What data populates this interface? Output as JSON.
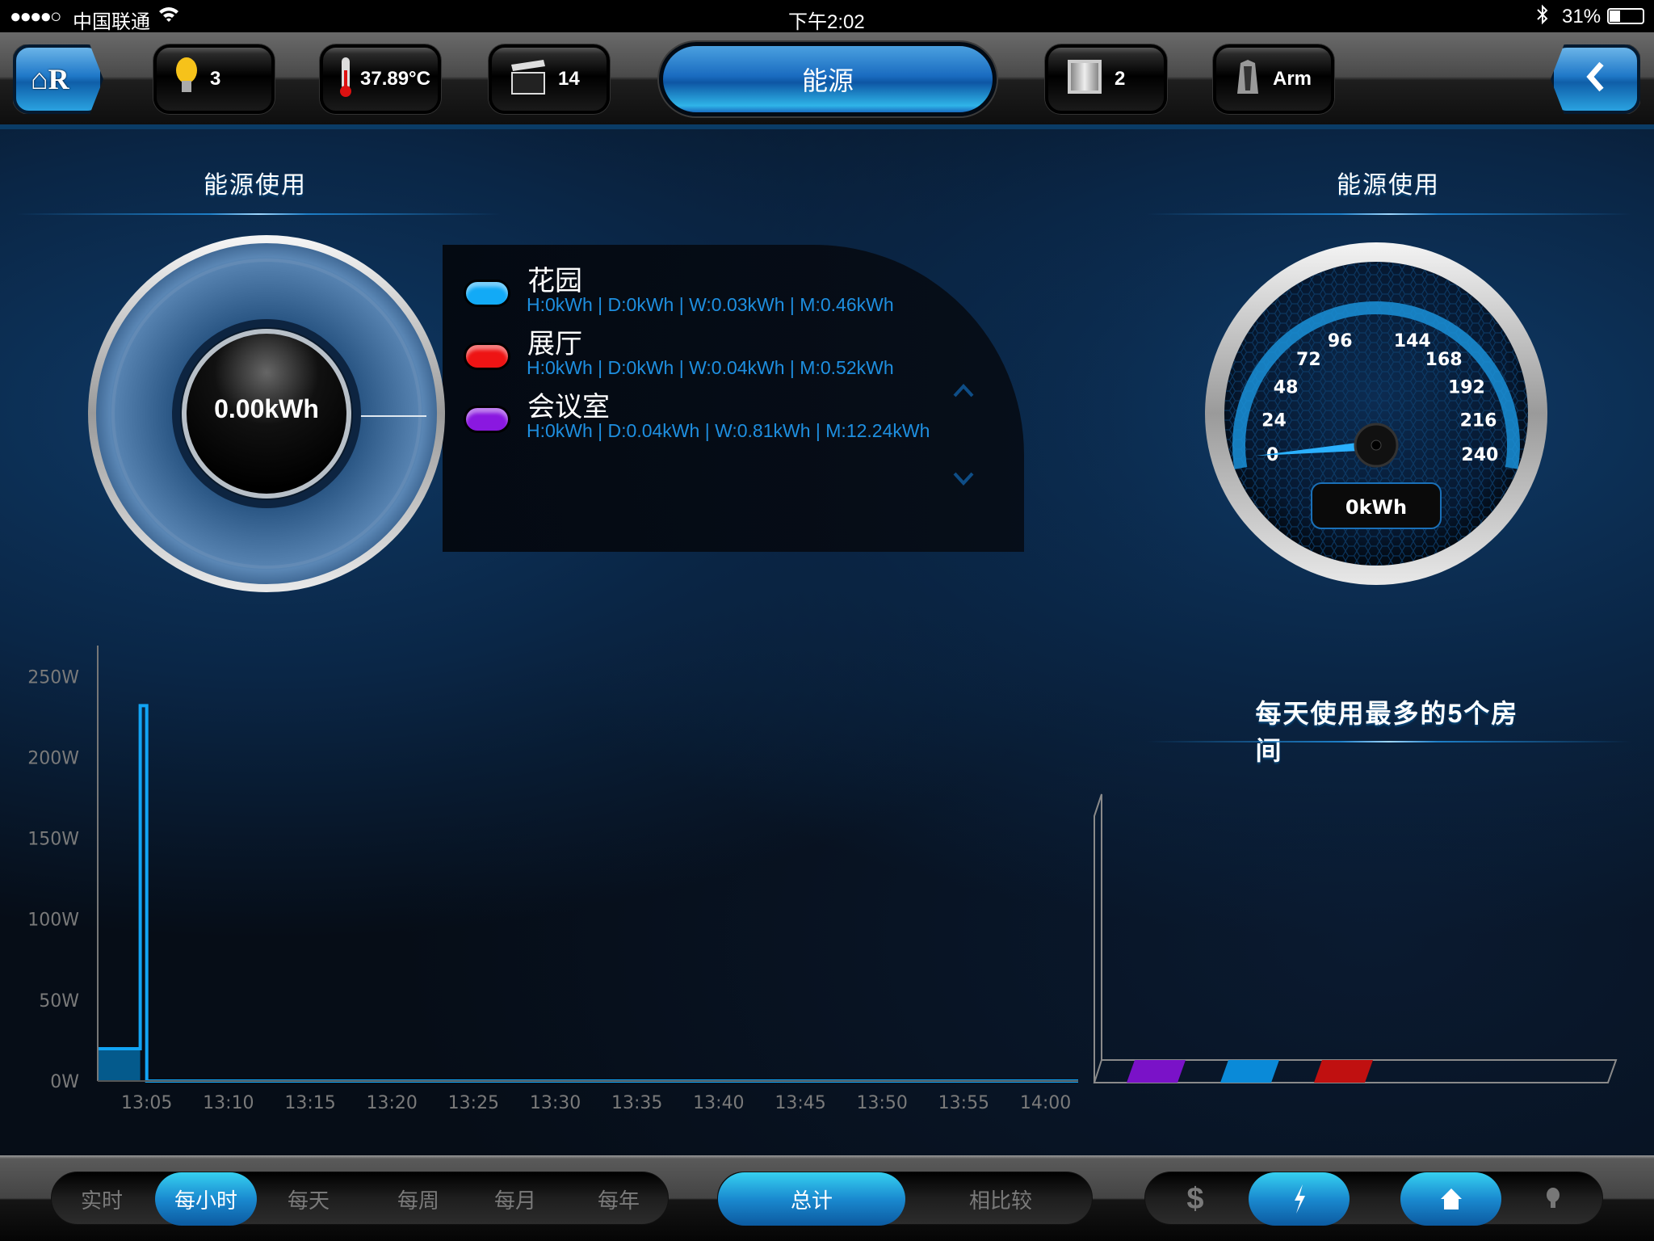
{
  "status_bar": {
    "signal": "●●●●○",
    "carrier": "中国联通",
    "time": "下午2:02",
    "battery": "31%"
  },
  "toolbar": {
    "lights_count": "3",
    "temperature": "37.89°C",
    "scenes_count": "14",
    "center_tab": "能源",
    "shades_count": "2",
    "security_label": "Arm"
  },
  "left_panel": {
    "title": "能源使用",
    "total_value": "0.00kWh"
  },
  "legend": {
    "rooms": [
      {
        "name": "花园",
        "detail": "H:0kWh | D:0kWh | W:0.03kWh | M:0.46kWh",
        "color": "#12aaf6"
      },
      {
        "name": "展厅",
        "detail": "H:0kWh | D:0kWh | W:0.04kWh | M:0.52kWh",
        "color": "#ee1414"
      },
      {
        "name": "会议室",
        "detail": "H:0kWh | D:0.04kWh | W:0.81kWh | M:12.24kWh",
        "color": "#8a18e0"
      }
    ]
  },
  "right_panel": {
    "title": "能源使用",
    "gauge": {
      "value": 0,
      "min": 0,
      "max": 240,
      "ticks": [
        "0",
        "24",
        "48",
        "72",
        "96",
        "144",
        "168",
        "192",
        "216",
        "240"
      ],
      "readout": "0kWh"
    }
  },
  "chart_data": [
    {
      "type": "area",
      "title": "",
      "xlabel": "",
      "ylabel": "",
      "y_ticks": [
        "0W",
        "50W",
        "100W",
        "150W",
        "200W",
        "250W"
      ],
      "ylim": [
        0,
        260
      ],
      "x_ticks": [
        "13:05",
        "13:10",
        "13:15",
        "13:20",
        "13:25",
        "13:30",
        "13:35",
        "13:40",
        "13:45",
        "13:50",
        "13:55",
        "14:00"
      ],
      "xlim": [
        "13:02",
        "14:02"
      ],
      "points": [
        [
          "13:02",
          20
        ],
        [
          "13:04.6",
          20
        ],
        [
          "13:04.6",
          232
        ],
        [
          "13:05",
          232
        ],
        [
          "13:05",
          0
        ],
        [
          "14:02",
          0
        ]
      ],
      "color": "#12a4f4",
      "grid": false
    },
    {
      "type": "bar",
      "title": "每天使用最多的5个房间",
      "values": [
        0,
        0,
        0
      ],
      "colors": [
        "#7a12c8",
        "#0a8ad8",
        "#c01010"
      ],
      "grid": false
    }
  ],
  "bottom_bar": {
    "periods": [
      "实时",
      "每小时",
      "每天",
      "每周",
      "每月",
      "每年"
    ],
    "active_period": 1,
    "modes": [
      "总计",
      "相比较"
    ],
    "active_mode": 0,
    "cost_icon": "$"
  }
}
